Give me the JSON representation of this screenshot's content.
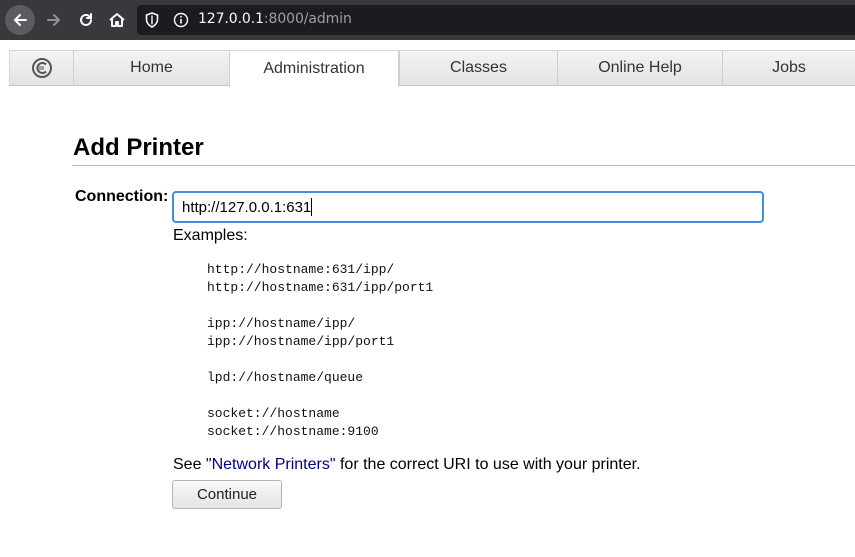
{
  "browser": {
    "url_host": "127.0.0.1",
    "url_rest": ":8000/admin",
    "icons": [
      "back-arrow-icon",
      "forward-arrow-icon",
      "reload-icon",
      "home-icon",
      "shield-icon",
      "info-icon"
    ]
  },
  "tabs": [
    {
      "label": "Home"
    },
    {
      "label": "Administration",
      "active": true
    },
    {
      "label": "Classes"
    },
    {
      "label": "Online Help"
    },
    {
      "label": "Jobs"
    }
  ],
  "page": {
    "title": "Add Printer",
    "connection_label": "Connection:",
    "connection_value": "http://127.0.0.1:631",
    "examples_label": "Examples:",
    "example_groups": [
      [
        "http://hostname:631/ipp/",
        "http://hostname:631/ipp/port1"
      ],
      [
        "ipp://hostname/ipp/",
        "ipp://hostname/ipp/port1"
      ],
      [
        "lpd://hostname/queue"
      ],
      [
        "socket://hostname",
        "socket://hostname:9100"
      ]
    ],
    "see_prefix": "See ",
    "see_link": "\"Network Printers\"",
    "see_suffix": " for the correct URI to use with your printer.",
    "continue_label": "Continue"
  },
  "colors": {
    "toolbar_bg": "#38383d",
    "urlbar_bg": "#1c1b22",
    "input_focus": "#3c8fe0",
    "link": "#000080"
  }
}
